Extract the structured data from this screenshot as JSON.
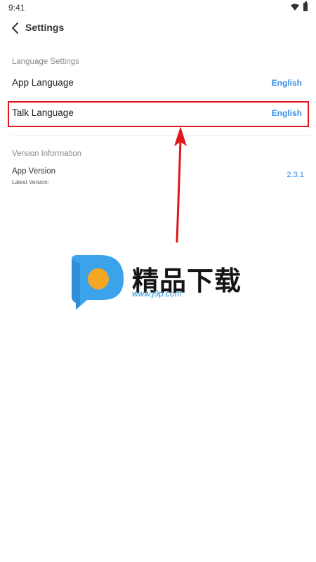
{
  "status": {
    "time": "9:41"
  },
  "header": {
    "title": "Settings"
  },
  "language_section": {
    "title": "Language Settings",
    "app_language": {
      "label": "App Language",
      "value": "English"
    },
    "talk_language": {
      "label": "Talk Language",
      "value": "English"
    }
  },
  "version_section": {
    "title": "Version Information",
    "app_version": {
      "label": "App Version",
      "sub": "Latest Version:",
      "value": "2.3.1"
    }
  },
  "watermark": {
    "text": "精品下载",
    "url": "www.j9p.com"
  },
  "colors": {
    "accent": "#3a8ee6",
    "highlight": "#e0161b",
    "logo_blue": "#3ba3ea",
    "logo_orange": "#f5a623"
  }
}
